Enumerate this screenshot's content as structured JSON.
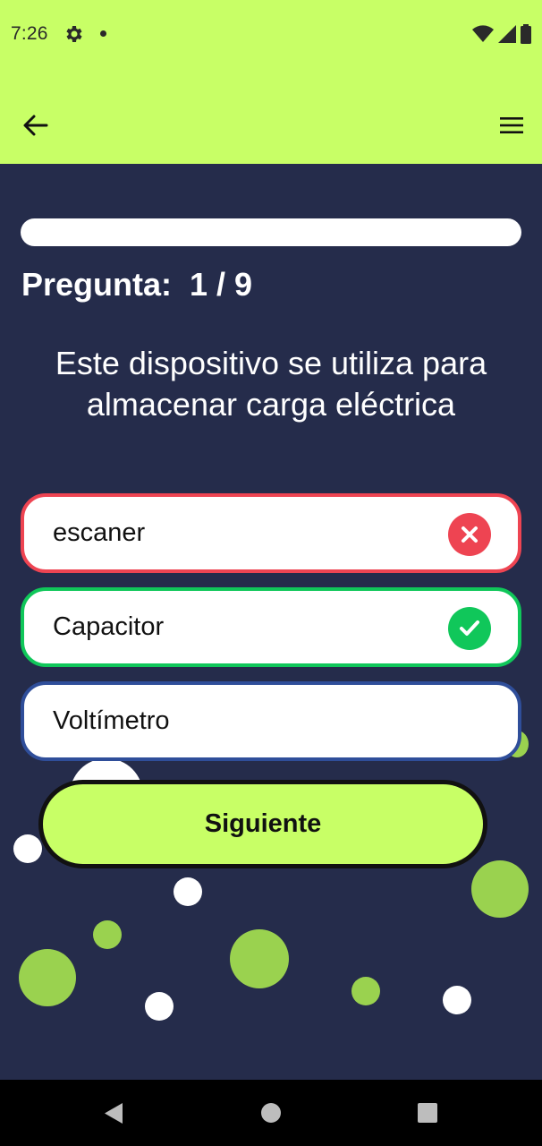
{
  "status_bar": {
    "time": "7:26",
    "icons": [
      "settings-gear-icon",
      "notification-dot-icon",
      "wifi-icon",
      "signal-icon",
      "battery-icon"
    ]
  },
  "app_bar": {
    "back_icon": "arrow-left-icon",
    "menu_icon": "hamburger-menu-icon",
    "background": "#C8FF66"
  },
  "quiz": {
    "progress_fraction": 1.0,
    "question_label": "Pregunta:",
    "question_number": "1 / 9",
    "question_text": "Este dispositivo se utiliza para almacenar carga eléctrica",
    "options": [
      {
        "label": "escaner",
        "state": "wrong",
        "icon": "x-circle-icon"
      },
      {
        "label": "Capacitor",
        "state": "correct",
        "icon": "check-circle-icon"
      },
      {
        "label": "Voltímetro",
        "state": "neutral",
        "icon": ""
      }
    ],
    "next_button": "Siguiente"
  },
  "colors": {
    "background": "#252C4B",
    "accent": "#C8FF66",
    "wrong": "#EE4452",
    "correct": "#10C75A",
    "neutral_border": "#2F4E9A"
  },
  "nav_bar": {
    "icons": [
      "nav-back-icon",
      "nav-home-icon",
      "nav-recent-icon"
    ]
  }
}
